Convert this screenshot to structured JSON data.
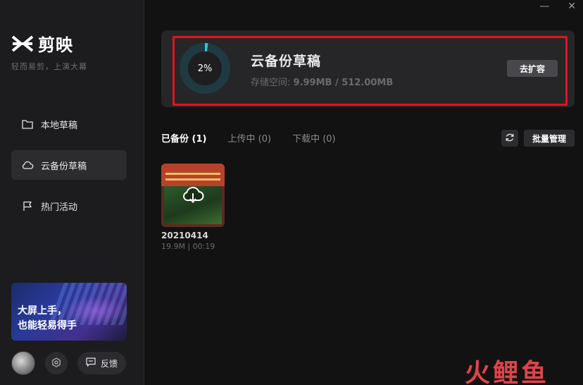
{
  "app": {
    "name": "剪映",
    "slogan": "轻而易剪，上演大幕"
  },
  "window_controls": {
    "minimize": "—",
    "close": "✕"
  },
  "sidebar": {
    "items": [
      {
        "label": "本地草稿",
        "icon": "folder-icon",
        "active": false
      },
      {
        "label": "云备份草稿",
        "icon": "cloud-icon",
        "active": true
      },
      {
        "label": "热门活动",
        "icon": "flag-icon",
        "active": false
      }
    ],
    "promo": {
      "line1": "大屏上手，",
      "line2": "也能轻易得手"
    },
    "feedback_label": "反馈"
  },
  "storage": {
    "percent_label": "2%",
    "percent_value": 0.02,
    "title": "云备份草稿",
    "sub_label": "存储空间:",
    "sub_value": "9.99MB / 512.00MB",
    "expand_label": "去扩容"
  },
  "tabs": [
    {
      "label": "已备份",
      "count": "(1)",
      "active": true
    },
    {
      "label": "上传中",
      "count": "(0)",
      "active": false
    },
    {
      "label": "下载中",
      "count": "(0)",
      "active": false
    }
  ],
  "batch_label": "批量管理",
  "drafts": [
    {
      "name": "20210414",
      "meta": "19.9M | 00:19"
    }
  ],
  "watermark": "火鲤鱼",
  "colors": {
    "accent": "#2ec4d6",
    "highlight_border": "#e3141a",
    "background": "#121212",
    "sidebar": "#1c1c1e"
  }
}
